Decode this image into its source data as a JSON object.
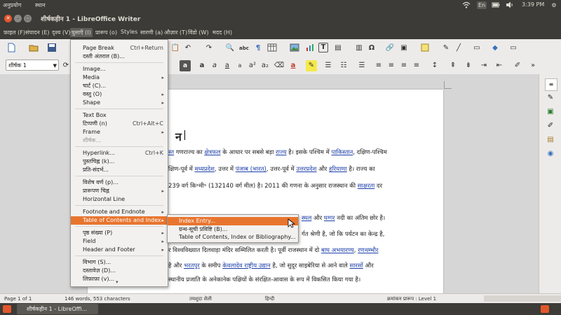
{
  "system_bar": {
    "app_menu_1": "अनुप्रयोग",
    "app_menu_2": "स्थान",
    "keyboard_indicator": "En",
    "clock": "3:39 PM"
  },
  "window": {
    "title": "शीर्षकहीन 1 - LibreOffice Writer"
  },
  "menubar": {
    "items": [
      "फ़ाइल (F)",
      "संपादन (E)",
      "दृश्य (V)",
      "घुसाएँ (I)",
      "प्रारूप (o)",
      "Styles",
      "सारणी (a)",
      "औज़ार (T)",
      "विंडो (W)",
      "मदद (H)"
    ]
  },
  "toolbar": {
    "paragraph_style": "शीर्षक 1"
  },
  "insert_menu": {
    "items": [
      {
        "label": "Page Break",
        "shortcut": "Ctrl+Return"
      },
      {
        "label": "दस्ती अंतराल (B)..."
      },
      {
        "label": "Image..."
      },
      {
        "label": "Media"
      },
      {
        "label": "चार्ट (C)..."
      },
      {
        "label": "वस्तु (O)"
      },
      {
        "label": "Shape"
      },
      {
        "label": "Text Box"
      },
      {
        "label": "टिप्पणी (n)",
        "shortcut": "Ctrl+Alt+C"
      },
      {
        "label": "Frame"
      },
      {
        "label": "शीर्षक..."
      },
      {
        "label": "Hyperlink...",
        "shortcut": "Ctrl+K"
      },
      {
        "label": "पुस्तचिह्न (k)..."
      },
      {
        "label": "प्रति-संदर्भ..."
      },
      {
        "label": "विशेष वर्ण (p)..."
      },
      {
        "label": "प्रारूपण चिह्न"
      },
      {
        "label": "Horizontal Line"
      },
      {
        "label": "Footnote and Endnote"
      },
      {
        "label": "Table of Contents and Index"
      },
      {
        "label": "पृष्ठ संख्या (P)"
      },
      {
        "label": "Field"
      },
      {
        "label": "Header and Footer"
      },
      {
        "label": "विभाग (S)..."
      },
      {
        "label": "दस्तावेज़ (D)..."
      },
      {
        "label": "लिफ़ाफ़ा (v)..."
      }
    ]
  },
  "toc_submenu": {
    "items": [
      {
        "label": "Index Entry..."
      },
      {
        "label": "ग्रन्थ-सूची प्रविष्टि (B)..."
      },
      {
        "label": "Table of Contents, Index or Bibliography..."
      }
    ]
  },
  "document": {
    "heading_fragment": "न",
    "lines": [
      {
        "parts": [
          {
            "t": "स्त",
            "link": true
          },
          {
            "t": " गणराज्य का "
          },
          {
            "t": "क्षेत्रफल",
            "link": true
          },
          {
            "t": " के आधार पर सबसे बड़ा "
          },
          {
            "t": "राज्य",
            "link": true
          },
          {
            "t": " है। इसके पश्चिम में "
          },
          {
            "t": "पाकिस्तान",
            "link": true
          },
          {
            "t": ", दक्षिण-पश्चिम"
          }
        ]
      },
      {
        "parts": [
          {
            "t": "क्षिण-पूर्व में "
          },
          {
            "t": "मध्यप्रदेश",
            "link": true
          },
          {
            "t": ", उत्तर में "
          },
          {
            "t": "पंजाब (भारत)",
            "link": true
          },
          {
            "t": ", उत्तर-पूर्व में "
          },
          {
            "t": "उत्तरप्रदेश",
            "link": true
          },
          {
            "t": " और "
          },
          {
            "t": "हरियाणा",
            "link": true
          },
          {
            "t": " है। राज्य का"
          }
        ]
      },
      {
        "parts": [
          {
            "t": "239 वर्ग कि॰मी॰ (132140 वर्ग मील) है। 2011 की गणना के अनुसार राजस्थान की "
          },
          {
            "t": "साक्षरता",
            "link": true
          },
          {
            "t": " दर"
          }
        ]
      },
      {
        "parts": [
          {
            "t": "स्थल",
            "link": true
          },
          {
            "t": " और "
          },
          {
            "t": "घग्गर",
            "link": true
          },
          {
            "t": " नदी का अंतिम छोर है।"
          }
        ]
      },
      {
        "parts": [
          {
            "t": "र्गत श्रेणी है, जो कि पर्यटन का केन्द्र है,"
          }
        ]
      },
      {
        "parts": [
          {
            "t": "र विश्वविख्यात दिलवाड़ा मंदिर सम्मिलित करती है। पूर्वी राजस्थान में दो "
          },
          {
            "t": "बाघ अभयारण्य",
            "link": true
          },
          {
            "t": ", "
          },
          {
            "t": "रणथम्भौर",
            "link": true
          }
        ]
      },
      {
        "parts": [
          {
            "t": "है और "
          },
          {
            "t": "भरतपुर",
            "link": true
          },
          {
            "t": " के समीप "
          },
          {
            "t": "केवलादेव राष्ट्रीय उद्यान",
            "link": true
          },
          {
            "t": " है, जो सुदूर साइबेरिया से आने वाले "
          },
          {
            "t": "सारसों",
            "link": true
          },
          {
            "t": " और"
          }
        ]
      },
      {
        "parts": [
          {
            "t": "स्थानीय प्रजाति के अनेकानेक पक्षियों के संरक्षित-आवास के रूप में विकसित किया गया है।"
          }
        ]
      }
    ]
  },
  "statusbar": {
    "page": "Page 1 of 1",
    "words": "146 words, 553 characters",
    "style": "तयशुदा शैली",
    "language": "हिन्दी",
    "outline": "क्रमांकन प्रारूप : Level 1"
  },
  "taskbar": {
    "task_label": "शीर्षकहीन 1 - LibreOffi..."
  },
  "colors": {
    "highlight": "#e8752f",
    "link": "#1c3fa8",
    "dark_chrome": "#3c3b37"
  }
}
